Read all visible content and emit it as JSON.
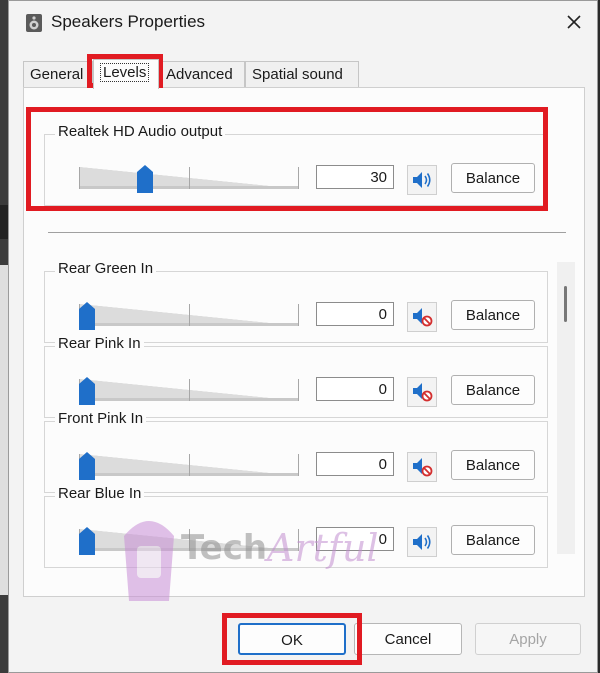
{
  "window": {
    "title": "Speakers Properties",
    "icon": "speaker-icon",
    "close_icon": "close-icon"
  },
  "tabs": [
    {
      "label": "General",
      "active": false
    },
    {
      "label": "Levels",
      "active": true
    },
    {
      "label": "Advanced",
      "active": false
    },
    {
      "label": "Spatial sound",
      "active": false
    }
  ],
  "main_output": {
    "label": "Realtek HD Audio output",
    "value": "30",
    "level": 0.3,
    "muted": false,
    "balance_label": "Balance"
  },
  "inputs": [
    {
      "label": "Rear Green In",
      "value": "0",
      "level": 0,
      "muted": true,
      "balance_label": "Balance"
    },
    {
      "label": "Rear Pink In",
      "value": "0",
      "level": 0,
      "muted": true,
      "balance_label": "Balance"
    },
    {
      "label": "Front Pink In",
      "value": "0",
      "level": 0,
      "muted": true,
      "balance_label": "Balance"
    },
    {
      "label": "Rear Blue In",
      "value": "0",
      "level": 0,
      "muted": false,
      "balance_label": "Balance"
    }
  ],
  "footer": {
    "ok_label": "OK",
    "cancel_label": "Cancel",
    "apply_label": "Apply"
  },
  "watermark": {
    "text_1": "Tech",
    "text_2": "Artful"
  },
  "colors": {
    "highlight": "#e11b22",
    "accent": "#1f6fc9",
    "slider_thumb": "#1f6fc9",
    "mute": "#d32f2f"
  }
}
